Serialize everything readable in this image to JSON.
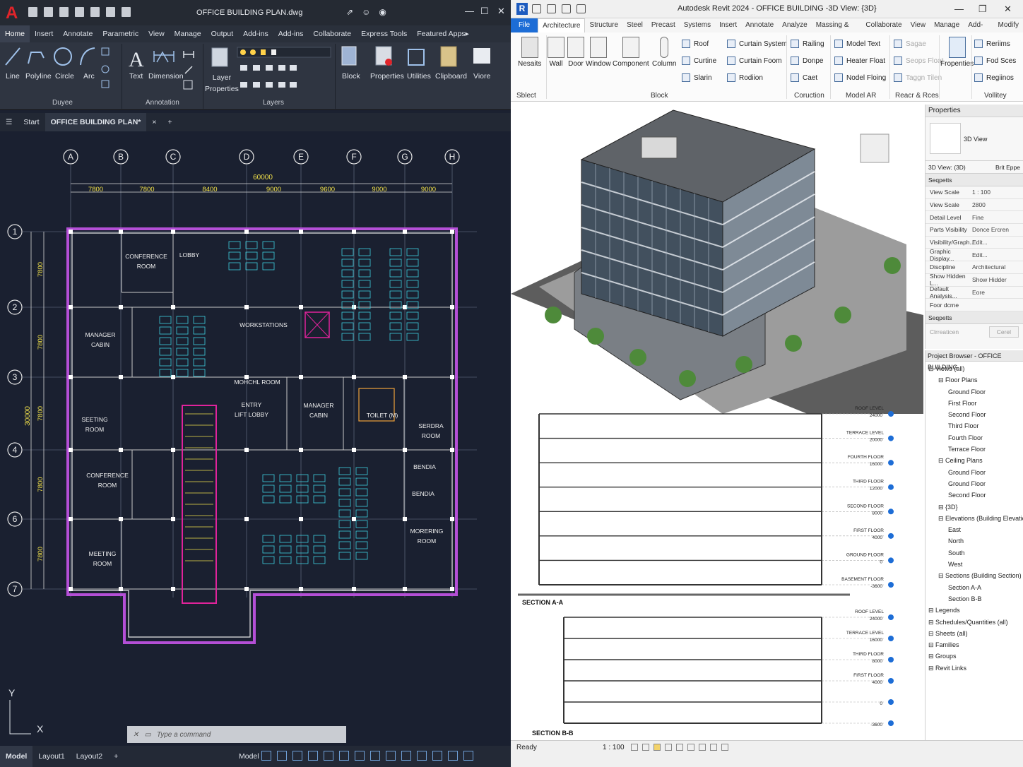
{
  "autocad": {
    "doc_title": "OFFICE BUILDING PLAN.dwg",
    "menu": [
      "Home",
      "Insert",
      "Annotate",
      "Parametric",
      "View",
      "Manage",
      "Output",
      "Add-ins",
      "Add-ins",
      "Collaborate",
      "Express Tools",
      "Featured Apps▸"
    ],
    "ribbon": {
      "draw": [
        "Line",
        "Polyline",
        "Circle",
        "Arc"
      ],
      "draw_group": "Duyee",
      "text": "Text",
      "dimension": "Dimension",
      "annotation_group": "Annotation",
      "layer_props": "Layer\nProperties",
      "layers_group": "Layers",
      "right": [
        "Block",
        "Properties",
        "Utilities",
        "Clipboard",
        "Viore"
      ]
    },
    "tabs": {
      "start": "Start",
      "file": "OFFICE BUILDING PLAN*"
    },
    "grid_cols": [
      "A",
      "B",
      "C",
      "D",
      "E",
      "F",
      "G",
      "H"
    ],
    "grid_rows": [
      "1",
      "2",
      "3",
      "4",
      "6",
      "7"
    ],
    "dims_top": [
      "7800",
      "7800",
      "8400",
      "9000",
      "9600",
      "9000",
      "9000"
    ],
    "dim_total": "60000",
    "dims_left": [
      "7800",
      "7800",
      "7800",
      "7800",
      "7800"
    ],
    "dim_left_total": "30000",
    "rooms": [
      "CONFERENCE\nROOM",
      "LOBBY",
      "WORKSTATIONS",
      "MANAGER\nCABIN",
      "MOHCHL ROOM",
      "ENTRY\nLIFT LOBBY",
      "MANAGER\nCABIN",
      "TOILET (M)",
      "SERDRA\nROOM",
      "SEETING\nROOM",
      "CONFERENCE\nROOM",
      "MEETING\nROOM",
      "MORERING\nROOM",
      "BENDIA",
      "BENDIA"
    ],
    "command_placeholder": "Type a command",
    "status": {
      "model": "Model",
      "layout1": "Layout1",
      "layout2": "Layout2",
      "add": "+",
      "model_btn": "Model"
    },
    "axes": {
      "x": "X",
      "y": "Y"
    }
  },
  "revit": {
    "title": "Autodesk Revit 2024 - OFFICE BUILDING -3D View: {3D}",
    "menu": [
      "File",
      "Architecture",
      "Structure",
      "Steel",
      "Precast",
      "Systems",
      "Insert",
      "Annotate",
      "Analyze",
      "Massing & Site",
      "Collaborate",
      "View",
      "Manage",
      "Add-Ins",
      "Modify"
    ],
    "ribbon": {
      "modify": "Nesaits",
      "select": "Sblect",
      "build": [
        "Wall",
        "Door",
        "Window",
        "Component",
        "Column"
      ],
      "roof_col": [
        "Roof",
        "Curtine",
        "Slarin"
      ],
      "curtain_col": [
        "Curtain System",
        "Curtain Foom",
        "Rodiion"
      ],
      "railing_col": [
        "Railing",
        "Donpe",
        "Caet"
      ],
      "model_col": [
        "Model Text",
        "Heater Float",
        "Nodel Floing"
      ],
      "circ_col": [
        "Sagae",
        "Seops Float",
        "Taggn Tilen"
      ],
      "properties": "Fropenties",
      "far_col": [
        "Reriims",
        "Fod Sces",
        "Regiinos"
      ],
      "groups": {
        "block": "Block",
        "circulation": "Coruction",
        "model": "Model AR",
        "room": "Reacr & Rces",
        "vollitey": "Vollitey"
      }
    },
    "props": {
      "title": "Properties",
      "family": "3D View",
      "selector": "3D View: (3D)",
      "edit_type": "Brit Eppe",
      "section1": "Seqpetts",
      "rows": [
        {
          "k": "View Scale",
          "v": "1 : 100"
        },
        {
          "k": "View Scale",
          "v": "2800"
        },
        {
          "k": "Detail Level",
          "v": "Fine"
        },
        {
          "k": "Parts Visibility",
          "v": "Donce Ercren"
        },
        {
          "k": "Visibility/Graph...",
          "v": "Edit..."
        },
        {
          "k": "Graphic Display...",
          "v": "Edit..."
        },
        {
          "k": "Discipline",
          "v": "Architectural"
        },
        {
          "k": "Show Hidden L...",
          "v": "Show Hidder"
        },
        {
          "k": "Default Analysis...",
          "v": "Eore"
        },
        {
          "k": "Foor dcrne",
          "v": ""
        }
      ],
      "section2": "Seqpetts",
      "apply": "Cerel",
      "apply_left": "Clrreaticen"
    },
    "browser": {
      "title": "Project Browser - OFFICE BUILDING",
      "items": [
        {
          "t": "Views (all)",
          "l": 0
        },
        {
          "t": "Floor Plans",
          "l": 1
        },
        {
          "t": "Ground Floor",
          "l": 2
        },
        {
          "t": "First Floor",
          "l": 2
        },
        {
          "t": "Second Floor",
          "l": 2
        },
        {
          "t": "Third Floor",
          "l": 2
        },
        {
          "t": "Fourth Floor",
          "l": 2
        },
        {
          "t": "Terrace Floor",
          "l": 2
        },
        {
          "t": "Ceiling Plans",
          "l": 1
        },
        {
          "t": "Ground Floor",
          "l": 2
        },
        {
          "t": "Ground Floor",
          "l": 2
        },
        {
          "t": "Second Floor",
          "l": 2
        },
        {
          "t": "{3D}",
          "l": 1
        },
        {
          "t": "Elevations (Building Elevation)",
          "l": 1
        },
        {
          "t": "East",
          "l": 2
        },
        {
          "t": "North",
          "l": 2
        },
        {
          "t": "South",
          "l": 2
        },
        {
          "t": "West",
          "l": 2
        },
        {
          "t": "Sections (Building Section)",
          "l": 1
        },
        {
          "t": "Section A-A",
          "l": 2
        },
        {
          "t": "Section B-B",
          "l": 2
        },
        {
          "t": "Legends",
          "l": 0
        },
        {
          "t": "Schedules/Quantities (all)",
          "l": 0
        },
        {
          "t": "Sheets (all)",
          "l": 0
        },
        {
          "t": "Families",
          "l": 0
        },
        {
          "t": "Groups",
          "l": 0
        },
        {
          "t": "Revit Links",
          "l": 0
        }
      ]
    },
    "section_a": {
      "label": "SECTION A-A",
      "levels": [
        {
          "n": "ROOF LEVEL",
          "v": "24000"
        },
        {
          "n": "TERRACE LEVEL",
          "v": "20000"
        },
        {
          "n": "FOURTH FLOOR",
          "v": "16000"
        },
        {
          "n": "THIRD FLOOR",
          "v": "12000"
        },
        {
          "n": "SECOND FLOOR",
          "v": "8000"
        },
        {
          "n": "FIRST FLOOR",
          "v": "4000"
        },
        {
          "n": "GROUND FLOOR",
          "v": "0"
        },
        {
          "n": "BASEMENT FLOOR",
          "v": "-3600"
        }
      ]
    },
    "section_b": {
      "label": "SECTION B-B",
      "levels": [
        {
          "n": "ROOF LEVEL",
          "v": "24000"
        },
        {
          "n": "TERRACE LEVEL",
          "v": "16000"
        },
        {
          "n": "THIRD FLOOR",
          "v": "8000"
        },
        {
          "n": "FIRST FLOOR",
          "v": "4000"
        },
        {
          "n": "",
          "v": "0"
        },
        {
          "n": "",
          "v": "-3600"
        }
      ]
    },
    "status": {
      "ready": "Ready",
      "scale": "1 : 100"
    }
  }
}
